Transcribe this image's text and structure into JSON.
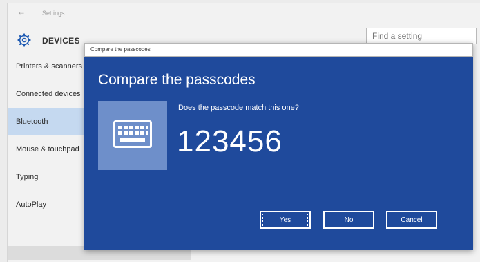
{
  "settings": {
    "title": "Settings",
    "back_glyph": "←",
    "section": "DEVICES",
    "search_placeholder": "Find a setting",
    "sidebar": [
      {
        "label": "Printers & scanners",
        "selected": false
      },
      {
        "label": "Connected devices",
        "selected": false
      },
      {
        "label": "Bluetooth",
        "selected": true
      },
      {
        "label": "Mouse & touchpad",
        "selected": false
      },
      {
        "label": "Typing",
        "selected": false
      },
      {
        "label": "AutoPlay",
        "selected": false
      }
    ]
  },
  "dialog": {
    "window_title": "Compare the passcodes",
    "heading": "Compare the passcodes",
    "question": "Does the passcode match this one?",
    "passcode": "123456",
    "buttons": {
      "yes": "Yes",
      "no": "No",
      "cancel": "Cancel"
    }
  },
  "colors": {
    "dialog_bg": "#1f4a9c",
    "tile_bg": "#6e8fca",
    "selected_item": "#c5d9f0"
  },
  "icons": {
    "settings": "gear-icon",
    "tile": "keyboard-icon",
    "back": "back-arrow-icon"
  }
}
